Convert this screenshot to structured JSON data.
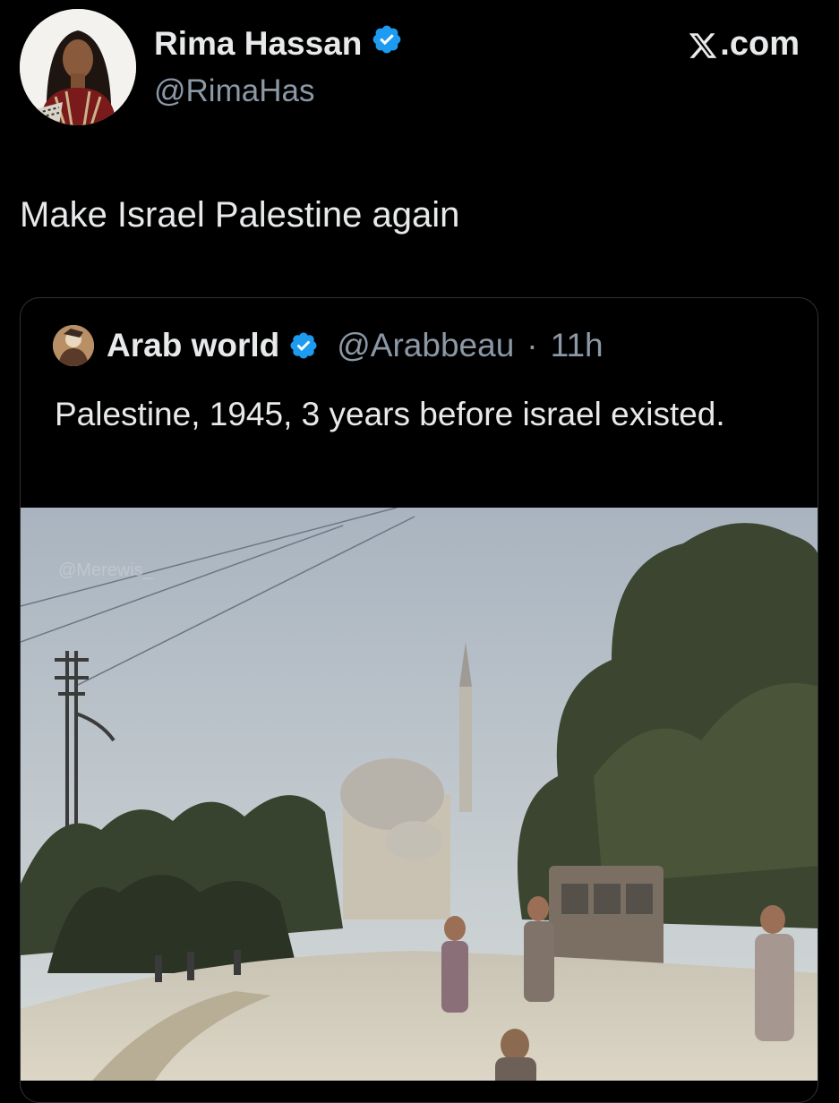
{
  "author": {
    "name": "Rima Hassan",
    "handle": "@RimaHas",
    "verified": true,
    "avatar_icon": "profile-photo"
  },
  "site": {
    "label": ".com",
    "logo_icon": "x-logo-icon"
  },
  "tweet": {
    "text": "Make Israel Palestine again"
  },
  "quoted_tweet": {
    "name": "Arab world",
    "handle": "@Arabbeau",
    "separator": "·",
    "time": "11h",
    "verified": true,
    "text": "Palestine, 1945, 3 years before israel existed.",
    "media": {
      "description_icon": "historical-street-photo",
      "watermark": "@Merewis_"
    }
  },
  "colors": {
    "background": "#000000",
    "text_primary": "#e7e9ea",
    "text_secondary": "#8b98a5",
    "verified_badge": "#1d9bf0",
    "border": "#2f3336"
  }
}
